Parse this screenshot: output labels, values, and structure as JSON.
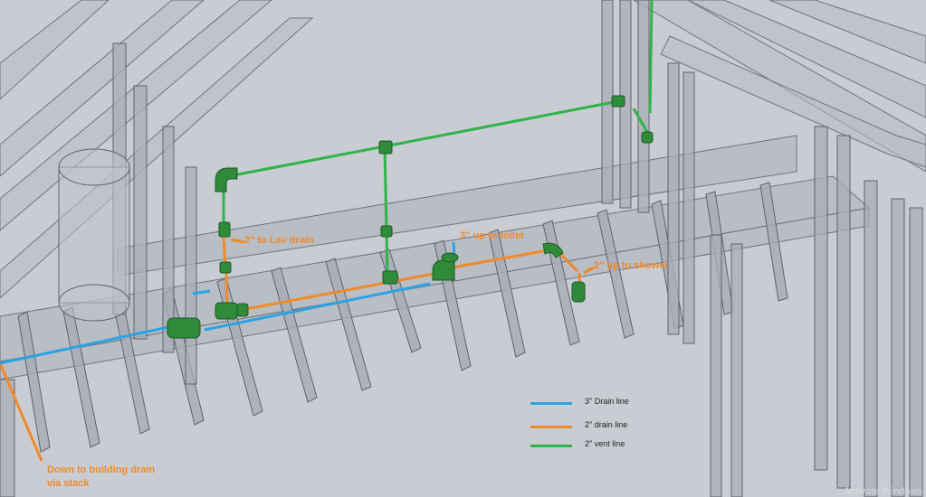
{
  "labels": {
    "lav_drain": "2\" to Lav drain",
    "toilet": "3\" up to toilet",
    "shower": "2\" up to shower",
    "building_drain": "Down to building drain via stack"
  },
  "legend": [
    {
      "label": "3\" Drain line",
      "color": "#2aa3e6"
    },
    {
      "label": "2\" drain line",
      "color": "#f08a2a"
    },
    {
      "label": "2\" vent line",
      "color": "#2fb34a"
    }
  ],
  "colors": {
    "drain3": "#2aa3e6",
    "drain2": "#f08a2a",
    "vent2": "#2fb34a",
    "fitting": "#2f8a3a",
    "framing": "#7e828c",
    "background": "#c9ccd3"
  },
  "watermark": "Activate Windows"
}
